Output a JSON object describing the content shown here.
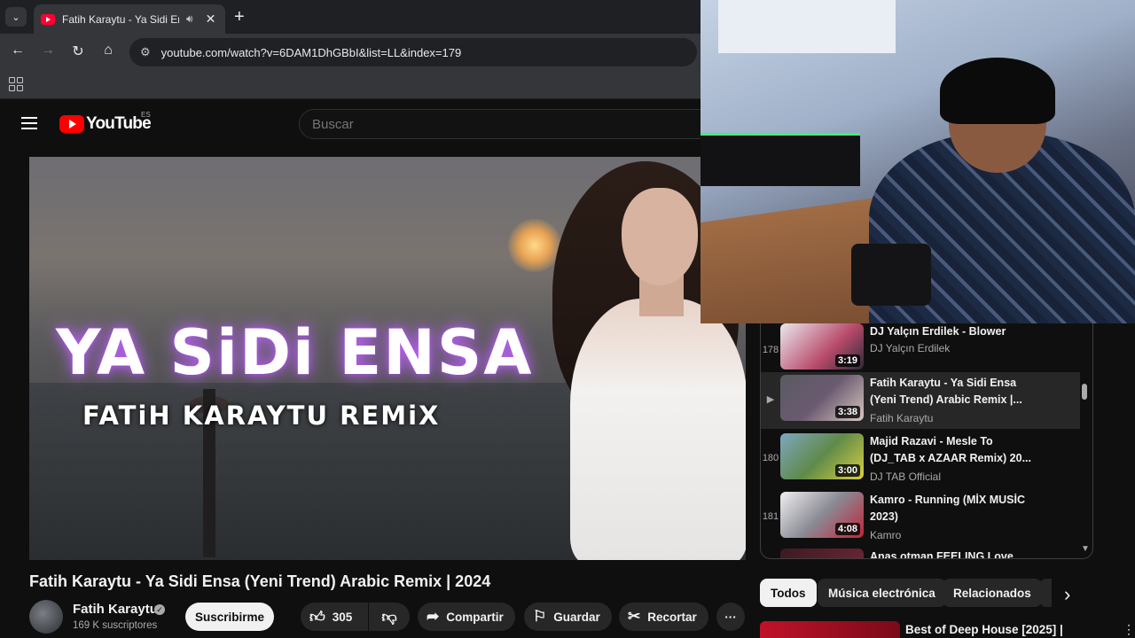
{
  "browser": {
    "tab_title": "Fatih Karaytu - Ya Sidi Ensa",
    "url": "youtube.com/watch?v=6DAM1DhGBbI&list=LL&index=179"
  },
  "youtube": {
    "logo_text": "YouTube",
    "region": "ES",
    "search_placeholder": "Buscar"
  },
  "player": {
    "thumbnail_title": "YA SiDi ENSA",
    "thumbnail_subtitle": "FATiH KARAYTU REMiX"
  },
  "playlist": {
    "items": [
      {
        "index": "178",
        "title": "DJ Yalçın Erdilek - Blower",
        "channel": "DJ Yalçın Erdilek",
        "duration": "3:19",
        "thumb_color": "#b84a6a"
      },
      {
        "index": "▶",
        "title": "Fatih Karaytu - Ya Sidi Ensa (Yeni Trend) Arabic Remix |...",
        "channel": "Fatih Karaytu",
        "duration": "3:38",
        "thumb_color": "#6a5a70"
      },
      {
        "index": "180",
        "title": "Majid Razavi - Mesle To (DJ_TAB x AZAAR Remix) 20...",
        "channel": "DJ TAB Official",
        "duration": "3:00",
        "thumb_color": "#5f8a4a"
      },
      {
        "index": "181",
        "title": "Kamro - Running (MİX MUSİC 2023)",
        "channel": "Kamro",
        "duration": "4:08",
        "thumb_color": "#8a8a95"
      },
      {
        "index": "",
        "title": "Anas otman FEELING Love",
        "channel": "",
        "duration": "",
        "thumb_color": "#7a2a3a"
      }
    ]
  },
  "video": {
    "title": "Fatih Karaytu - Ya Sidi Ensa (Yeni Trend) Arabic Remix | 2024",
    "channel": "Fatih Karaytu",
    "subscribers": "169 K suscriptores",
    "subscribe_label": "Suscribirme",
    "likes": "305",
    "share_label": "Compartir",
    "save_label": "Guardar",
    "clip_label": "Recortar",
    "more_label": "···"
  },
  "chips": [
    "Todos",
    "Música electrónica",
    "Relacionados"
  ],
  "recommended": {
    "title": "Best of Deep House [2025] |"
  },
  "colors": {
    "accent": "#ff0000",
    "background": "#0f0f0f"
  }
}
